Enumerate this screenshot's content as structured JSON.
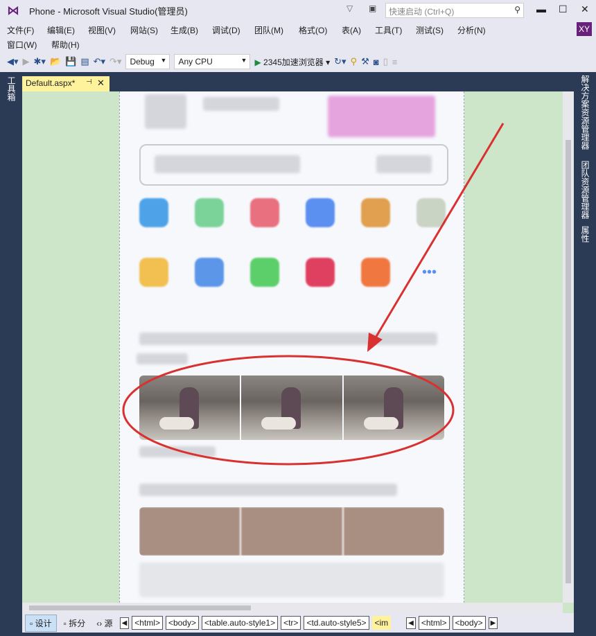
{
  "window": {
    "title": "Phone - Microsoft Visual Studio(管理员)",
    "quick_launch_placeholder": "快速启动 (Ctrl+Q)",
    "user_initials": "XY"
  },
  "menu": [
    "文件(F)",
    "编辑(E)",
    "视图(V)",
    "网站(S)",
    "生成(B)",
    "调试(D)",
    "团队(M)",
    "格式(O)",
    "表(A)",
    "工具(T)",
    "测试(S)",
    "分析(N)",
    "窗口(W)",
    "帮助(H)"
  ],
  "toolbar": {
    "configuration": "Debug",
    "platform": "Any CPU",
    "run_target": "2345加速浏览器"
  },
  "side_panels": {
    "left": "工具箱",
    "right": [
      "解决方案资源管理器",
      "团队资源管理器",
      "属性"
    ]
  },
  "document_tab": {
    "label": "Default.aspx*"
  },
  "view_buttons": [
    "设计",
    "拆分",
    "源"
  ],
  "breadcrumbs": [
    "<html>",
    "<body>",
    "<table.auto-style1>",
    "<tr>",
    "<td.auto-style5>",
    "<im"
  ],
  "breadcrumbs_right": [
    "<html>",
    "<body>"
  ],
  "annotation_color": "#d93030"
}
